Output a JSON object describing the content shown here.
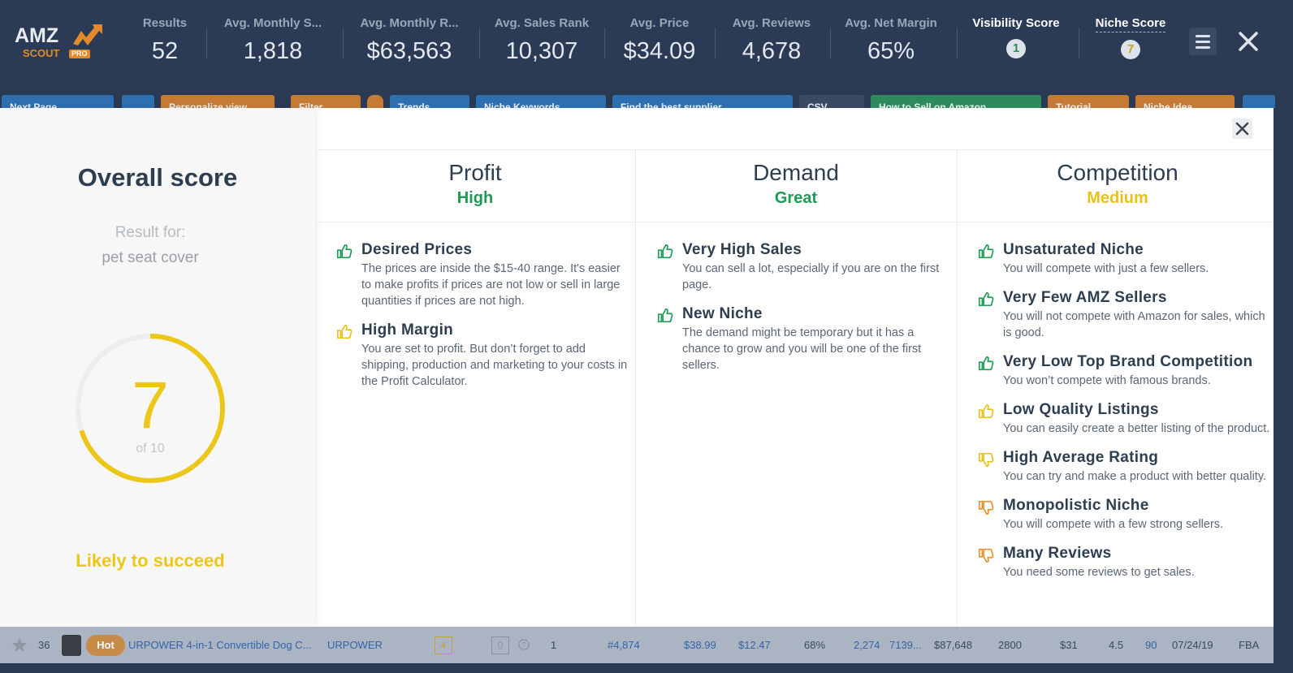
{
  "header": {
    "logo": {
      "amz": "AMZ",
      "scout": "SCOUT",
      "pro": "PRO"
    },
    "stats": [
      {
        "label": "Results",
        "value": "52"
      },
      {
        "label": "Avg. Monthly S...",
        "value": "1,818"
      },
      {
        "label": "Avg. Monthly R...",
        "value": "$63,563"
      },
      {
        "label": "Avg. Sales Rank",
        "value": "10,307"
      },
      {
        "label": "Avg. Price",
        "value": "$34.09"
      },
      {
        "label": "Avg. Reviews",
        "value": "4,678"
      },
      {
        "label": "Avg. Net Margin",
        "value": "65%"
      }
    ],
    "visibility": {
      "label": "Visibility Score",
      "value": "1"
    },
    "niche": {
      "label": "Niche Score",
      "value": "7"
    }
  },
  "toolbar": {
    "next_page": "Next Page",
    "personalize": "Personalize view",
    "filter": "Filter",
    "trends": "Trends",
    "niche_keywords": "Niche Keywords",
    "find_supplier": "Find the best supplier",
    "csv": "CSV",
    "how_to_sell": "How to Sell on Amazon",
    "tutorial": "Tutorial",
    "niche_idea": "Niche Idea"
  },
  "overall": {
    "title": "Overall score",
    "result_for": "Result for:",
    "term": "pet seat cover",
    "score": "7",
    "of": "of 10",
    "score_fraction": 0.7,
    "verdict": "Likely to succeed"
  },
  "columns": [
    {
      "title": "Profit",
      "rating": "High",
      "rating_color": "#1e9a55",
      "items": [
        {
          "icon": "thumbs-up",
          "color": "#1e9a55",
          "heading": "Desired Prices",
          "desc": "The prices are inside the $15-40 range. It's easier to make profits if prices are not low or sell in large quantities if prices are not high."
        },
        {
          "icon": "thumbs-up",
          "color": "#e8c21a",
          "heading": "High Margin",
          "desc": "You are set to profit. But don’t forget to add shipping, production and marketing to your costs in the Profit Calculator."
        }
      ]
    },
    {
      "title": "Demand",
      "rating": "Great",
      "rating_color": "#1e9a55",
      "items": [
        {
          "icon": "thumbs-up",
          "color": "#1e9a55",
          "heading": "Very High Sales",
          "desc": "You can sell a lot, especially if you are on the first page."
        },
        {
          "icon": "thumbs-up",
          "color": "#1e9a55",
          "heading": "New Niche",
          "desc": "The demand might be temporary but it has a chance to grow and you will be one of the first sellers."
        }
      ]
    },
    {
      "title": "Competition",
      "rating": "Medium",
      "rating_color": "#e8c21a",
      "items": [
        {
          "icon": "thumbs-up",
          "color": "#1e9a55",
          "heading": "Unsaturated Niche",
          "desc": "You will compete with just a few sellers."
        },
        {
          "icon": "thumbs-up",
          "color": "#1e9a55",
          "heading": "Very Few AMZ Sellers",
          "desc": "You will not compete with Amazon for sales, which is good."
        },
        {
          "icon": "thumbs-up",
          "color": "#1e9a55",
          "heading": "Very Low Top Brand Competition",
          "desc": "You won’t compete with famous brands."
        },
        {
          "icon": "thumbs-up",
          "color": "#e8c21a",
          "heading": "Low Quality Listings",
          "desc": "You can easily create a better listing of the product."
        },
        {
          "icon": "thumbs-down",
          "color": "#e8c21a",
          "heading": "High Average Rating",
          "desc": "You can try and make a product with better quality."
        },
        {
          "icon": "thumbs-down",
          "color": "#e8902a",
          "heading": "Monopolistic Niche",
          "desc": "You will compete with a few strong sellers."
        },
        {
          "icon": "thumbs-down",
          "color": "#e8902a",
          "heading": "Many Reviews",
          "desc": "You need some reviews to get sales."
        }
      ]
    }
  ],
  "table_row": {
    "index": "36",
    "badge": "Hot",
    "product": "URPOWER 4-in-1 Convertible Dog C...",
    "brand": "URPOWER",
    "score_a": "4",
    "score_b": "0",
    "sellers": "1",
    "rank": "#4,874",
    "price": "$38.99",
    "fees": "$12.47",
    "margin": "68%",
    "sales": "2,274",
    "sales2": "7139...",
    "revenue": "$87,648",
    "reviews": "2800",
    "lqs": "$31",
    "rating": "4.5",
    "rating_count": "90",
    "date": "07/24/19",
    "tier": "FBA"
  }
}
